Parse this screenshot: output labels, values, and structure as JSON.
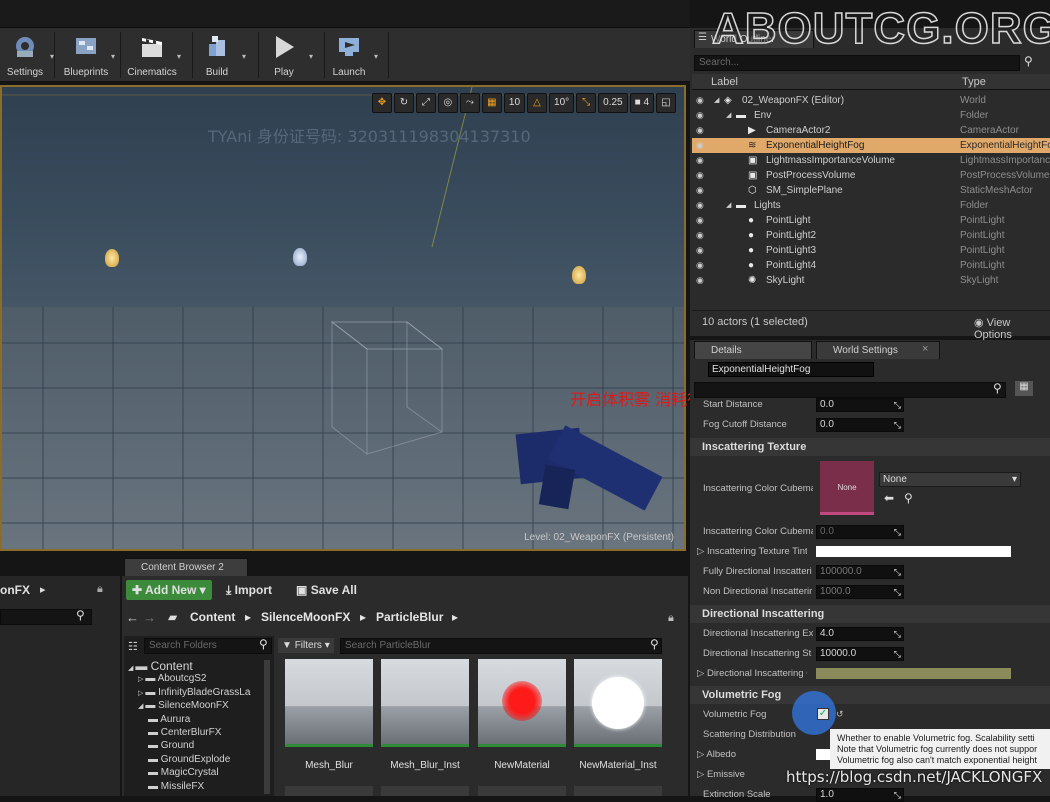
{
  "watermarks": {
    "site": "ABOUTCG.ORG",
    "overlay": "TYAni  身份证号码: 320311198304137310",
    "note": "开启体积雾  消耗很大",
    "url": "https://blog.csdn.net/JACKLONGFX"
  },
  "toolbar": {
    "buttons": [
      {
        "label": "Settings",
        "icon": "settings-icon"
      },
      {
        "label": "Blueprints",
        "icon": "blueprints-icon"
      },
      {
        "label": "Cinematics",
        "icon": "clapperboard-icon"
      },
      {
        "label": "Build",
        "icon": "build-icon"
      },
      {
        "label": "Play",
        "icon": "play-icon"
      },
      {
        "label": "Launch",
        "icon": "launch-icon"
      }
    ]
  },
  "viewport": {
    "grid_snap": "10",
    "rotate_snap": "10°",
    "scale_snap": "0.25",
    "camera_speed": "4",
    "level_label": "Level:  02_WeaponFX (Persistent)"
  },
  "outliner": {
    "title": "World Outliner",
    "search_placeholder": "Search...",
    "col_label": "Label",
    "col_type": "Type",
    "rows": [
      {
        "label": "02_WeaponFX (Editor)",
        "type": "World",
        "indent": 0,
        "selected": false
      },
      {
        "label": "Env",
        "type": "Folder",
        "indent": 1,
        "selected": false
      },
      {
        "label": "CameraActor2",
        "type": "CameraActor",
        "indent": 2,
        "selected": false
      },
      {
        "label": "ExponentialHeightFog",
        "type": "ExponentialHeightFog",
        "indent": 2,
        "selected": true
      },
      {
        "label": "LightmassImportanceVolume",
        "type": "LightmassImportanceVolume",
        "indent": 2,
        "selected": false
      },
      {
        "label": "PostProcessVolume",
        "type": "PostProcessVolume",
        "indent": 2,
        "selected": false
      },
      {
        "label": "SM_SimplePlane",
        "type": "StaticMeshActor",
        "indent": 2,
        "selected": false
      },
      {
        "label": "Lights",
        "type": "Folder",
        "indent": 1,
        "selected": false
      },
      {
        "label": "PointLight",
        "type": "PointLight",
        "indent": 2,
        "selected": false
      },
      {
        "label": "PointLight2",
        "type": "PointLight",
        "indent": 2,
        "selected": false
      },
      {
        "label": "PointLight3",
        "type": "PointLight",
        "indent": 2,
        "selected": false
      },
      {
        "label": "PointLight4",
        "type": "PointLight",
        "indent": 2,
        "selected": false
      },
      {
        "label": "SkyLight",
        "type": "SkyLight",
        "indent": 2,
        "selected": false
      }
    ],
    "status": "10 actors (1 selected)",
    "view_options": "View Options"
  },
  "details": {
    "tab_details": "Details",
    "tab_world": "World Settings",
    "object_name": "ExponentialHeightFog",
    "start_distance_label": "Start Distance",
    "start_distance": "0.0",
    "fog_cutoff_label": "Fog Cutoff Distance",
    "fog_cutoff": "0.0",
    "sec_inscatter_tex": "Inscattering Texture",
    "cubemap_label": "Inscattering Color Cubema",
    "cubemap_thumb": "None",
    "cubemap_value": "None",
    "cubemap_angle_label": "Inscattering Color Cubema",
    "cubemap_angle": "0.0",
    "tint_label": "Inscattering Texture Tint",
    "full_dir_label": "Fully Directional Inscatteri",
    "full_dir": "100000.0",
    "non_dir_label": "Non Directional Inscatterir",
    "non_dir": "1000.0",
    "sec_dir": "Directional Inscattering",
    "dir_exp_label": "Directional Inscattering Ex",
    "dir_exp": "4.0",
    "dir_start_label": "Directional Inscattering St",
    "dir_start": "10000.0",
    "dir_color_label": "Directional Inscattering Co",
    "sec_vol": "Volumetric Fog",
    "vol_fog_label": "Volumetric Fog",
    "scatter_label": "Scattering Distribution",
    "albedo_label": "Albedo",
    "emissive_label": "Emissive",
    "ext_label": "Extinction Scale",
    "ext_value": "1.0",
    "tooltip": [
      "Whether to enable Volumetric fog.  Scalability setti",
      "Note that Volumetric fog currently does not suppor",
      "Volumetric fog also can't match exponential height"
    ]
  },
  "content_browser": {
    "tab": "Content Browser 2",
    "left_title": "onFX",
    "add_new": "Add New",
    "import": "Import",
    "save_all": "Save All",
    "breadcrumb": [
      "Content",
      "SilenceMoonFX",
      "ParticleBlur"
    ],
    "search_folders": "Search Folders",
    "filters": "Filters",
    "search_assets": "Search ParticleBlur",
    "tree": [
      {
        "label": "Content",
        "depth": 0
      },
      {
        "label": "AboutcgS2",
        "depth": 1
      },
      {
        "label": "InfinityBladeGrassLa",
        "depth": 1
      },
      {
        "label": "SilenceMoonFX",
        "depth": 1
      },
      {
        "label": "Aurura",
        "depth": 2
      },
      {
        "label": "CenterBlurFX",
        "depth": 2
      },
      {
        "label": "Ground",
        "depth": 2
      },
      {
        "label": "GroundExplode",
        "depth": 2
      },
      {
        "label": "MagicCrystal",
        "depth": 2
      },
      {
        "label": "MissileFX",
        "depth": 2
      }
    ],
    "assets": [
      {
        "label": "Mesh_Blur"
      },
      {
        "label": "Mesh_Blur_Inst"
      },
      {
        "label": "NewMaterial"
      },
      {
        "label": "NewMaterial_Inst"
      }
    ]
  },
  "colors": {
    "accent": "#e0a96a",
    "add_new": "#3b8b3b",
    "viewport_border": "#8a6d2a"
  }
}
